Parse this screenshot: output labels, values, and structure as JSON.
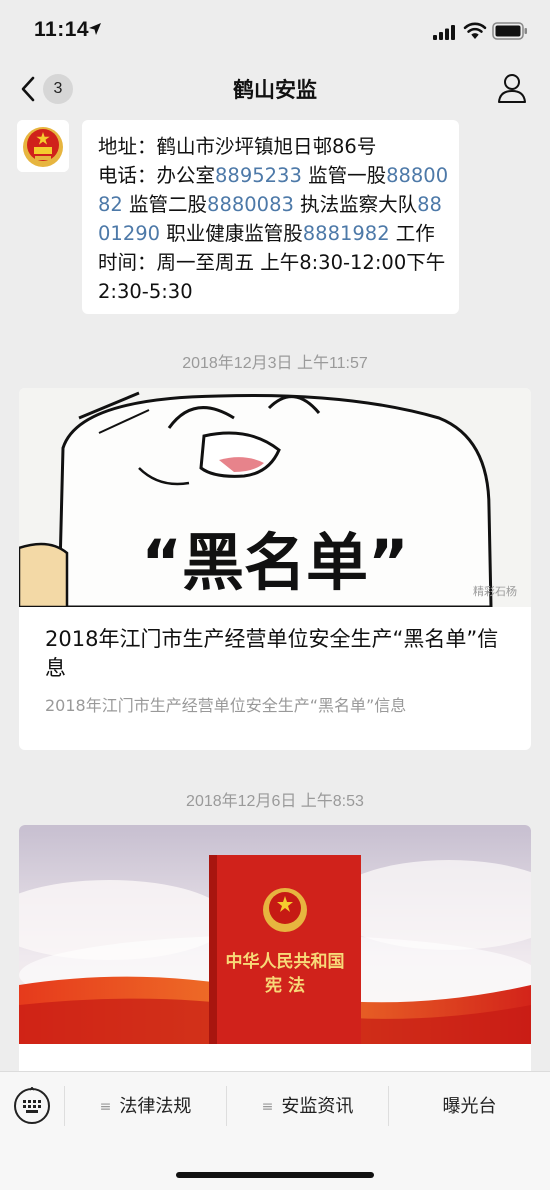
{
  "status_bar": {
    "time": "11:14"
  },
  "nav": {
    "unread_count": "3",
    "title": "鹤山安监"
  },
  "message": {
    "address": "地址：鹤山市沙坪镇旭日邨86号",
    "phone_label": "电话：办公室",
    "phone_office": "8895233",
    "label_supervision1": " 监管一股",
    "phone_supervision1": "8880082",
    "label_supervision2": " 监管二股",
    "phone_supervision2": "8880083",
    "label_enforcement": " 执法监察大队",
    "phone_enforcement": "8801290",
    "label_health": " 职业健康监管股",
    "phone_health": "8881982",
    "hours": " 工作时间：周一至周五 上午8:30-12:00下午2:30-5:30"
  },
  "articles": [
    {
      "timestamp": "2018年12月3日 上午11:57",
      "image_caption": "“黑名单”",
      "watermark": "精彩石杨",
      "title": "2018年江门市生产经营单位安全生产“黑名单”信息",
      "digest": "2018年江门市生产经营单位安全生产“黑名单”信息"
    },
    {
      "timestamp": "2018年12月6日 上午8:53",
      "book_title_line1": "中华人民共和国",
      "book_title_line2": "宪 法"
    }
  ],
  "bottom_menu": {
    "items": [
      {
        "label": "法律法规",
        "glyph": "≡"
      },
      {
        "label": "安监资讯",
        "glyph": "≡"
      },
      {
        "label": "曝光台"
      }
    ]
  },
  "colors": {
    "link": "#4d79a8",
    "background": "#ededed",
    "book_red": "#d0221b"
  }
}
